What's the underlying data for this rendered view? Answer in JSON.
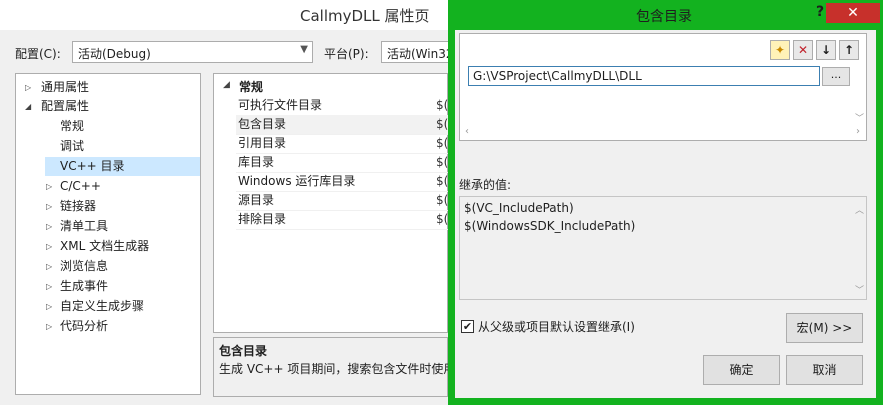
{
  "back": {
    "title": "CallmyDLL 属性页",
    "config_label": "配置(C):",
    "config_value": "活动(Debug)",
    "platform_label": "平台(P):",
    "platform_value": "活动(Win32",
    "tree": [
      {
        "label": "通用属性",
        "expander": "▷"
      },
      {
        "label": "配置属性",
        "expander": "◢"
      },
      {
        "label": "常规",
        "expander": ""
      },
      {
        "label": "调试",
        "expander": ""
      },
      {
        "label": "VC++ 目录",
        "expander": ""
      },
      {
        "label": "C/C++",
        "expander": "▷"
      },
      {
        "label": "链接器",
        "expander": "▷"
      },
      {
        "label": "清单工具",
        "expander": "▷"
      },
      {
        "label": "XML 文档生成器",
        "expander": "▷"
      },
      {
        "label": "浏览信息",
        "expander": "▷"
      },
      {
        "label": "生成事件",
        "expander": "▷"
      },
      {
        "label": "自定义生成步骤",
        "expander": "▷"
      },
      {
        "label": "代码分析",
        "expander": "▷"
      }
    ],
    "grid_section": "常规",
    "grid_rows": [
      {
        "name": "可执行文件目录",
        "value": "$("
      },
      {
        "name": "包含目录",
        "value": "$("
      },
      {
        "name": "引用目录",
        "value": "$("
      },
      {
        "name": "库目录",
        "value": "$("
      },
      {
        "name": "Windows 运行库目录",
        "value": "$("
      },
      {
        "name": "源目录",
        "value": "$("
      },
      {
        "name": "排除目录",
        "value": "$("
      }
    ],
    "desc_title": "包含目录",
    "desc_text": "生成 VC++ 项目期间，搜索包含文件时使用"
  },
  "dialog": {
    "title": "包含目录",
    "help": "?",
    "close": "✕",
    "toolbar": {
      "new_folder": "✦",
      "delete": "✕",
      "down": "↓",
      "up": "↑"
    },
    "path_value": "G:\\VSProject\\CallmyDLL\\DLL",
    "browse_label": "...",
    "inherited_label": "继承的值:",
    "inherited_values": [
      "$(VC_IncludePath)",
      "$(WindowsSDK_IncludePath)"
    ],
    "inherit_checkbox_label": "从父级或项目默认设置继承(I)",
    "inherit_checked": true,
    "macro_button": "宏(M) >>",
    "ok_button": "确定",
    "cancel_button": "取消"
  }
}
